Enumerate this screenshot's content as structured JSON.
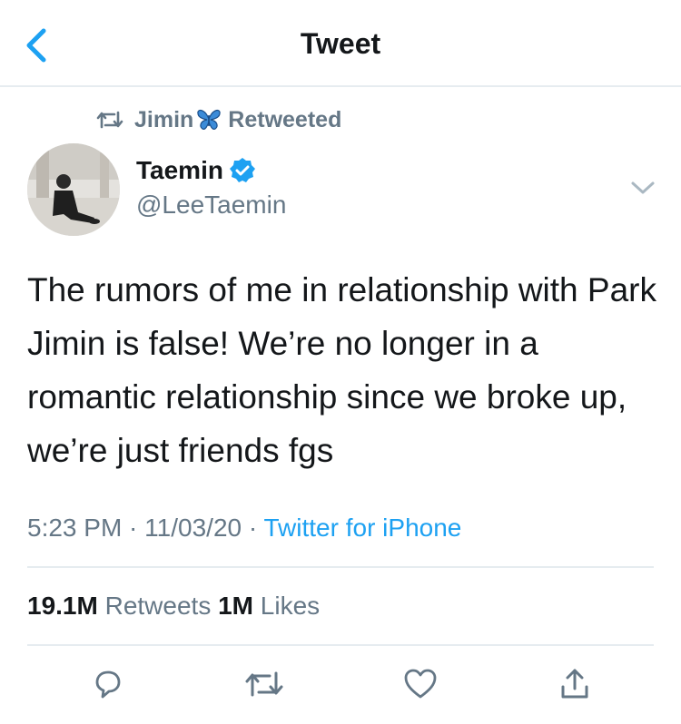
{
  "header": {
    "title": "Tweet",
    "back_icon": "chevron-left-icon"
  },
  "retweet_context": {
    "icon": "retweet-icon",
    "name": "Jimin",
    "emoji": "butterfly",
    "text": "Retweeted"
  },
  "author": {
    "name": "Taemin",
    "verified": true,
    "handle": "@LeeTaemin"
  },
  "tweet": {
    "text": "The rumors of me in relationship with Park Jimin is false! We’re no longer in a romantic relationship since we broke up, we’re just friends fgs",
    "time": "5:23 PM",
    "sep1": " · ",
    "date": "11/03/20",
    "sep2": " · ",
    "source": "Twitter for iPhone"
  },
  "stats": {
    "retweets_count": "19.1M",
    "retweets_label": "Retweets",
    "likes_count": "1M",
    "likes_label": "Likes"
  },
  "actions": [
    "reply-icon",
    "retweet-icon",
    "like-icon",
    "share-icon"
  ],
  "colors": {
    "accent": "#1da1f2",
    "text": "#14171a",
    "secondary": "#657786",
    "divider": "#e6ecf0"
  }
}
